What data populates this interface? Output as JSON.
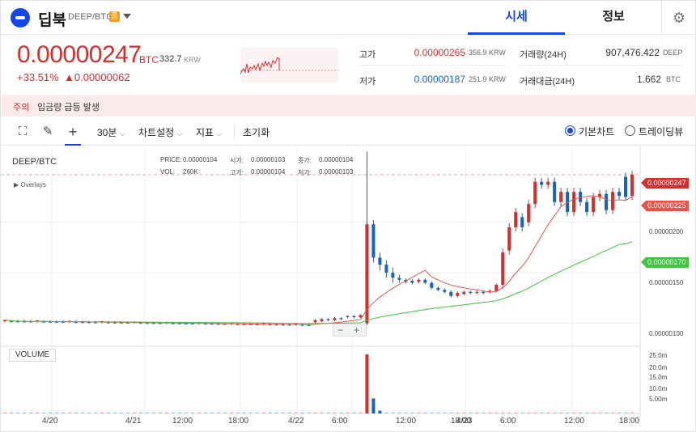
{
  "header": {
    "coin_name": "딥북",
    "pair": "DEEP/BTC",
    "pair_badge": "품",
    "tabs": [
      {
        "label": "시세"
      },
      {
        "label": "정보"
      }
    ]
  },
  "price": {
    "value": "0.00000247",
    "unit": "BTC",
    "krw": "332.7",
    "krw_unit": "KRW",
    "change_pct": "+33.51%",
    "change_abs": "▲0.00000062"
  },
  "stats": {
    "high_label": "고가",
    "high_value": "0.00000265",
    "high_krw": "356.9 KRW",
    "low_label": "저가",
    "low_value": "0.00000187",
    "low_krw": "251.9 KRW",
    "volume_label": "거래량(24H)",
    "volume_value": "907,476.422",
    "volume_unit": "DEEP",
    "amount_label": "거래대금(24H)",
    "amount_value": "1.662",
    "amount_unit": "BTC"
  },
  "alert": {
    "tag": "주의",
    "text": "입금량 급등 발생"
  },
  "toolbar": {
    "interval": "30분",
    "chart_settings": "차트설정",
    "indicators": "지표",
    "reset": "초기화",
    "basic_chart": "기본차트",
    "tradingview": "트레이딩뷰"
  },
  "legend": {
    "pair": "DEEP/BTC",
    "price_label": "PRICE:",
    "price_value": "0.00000104",
    "open_label": "시가:",
    "open_value": "0.00000103",
    "close_label": "종가:",
    "close_value": "0.00000104",
    "vol_label": "VOL:",
    "vol_value": "260K",
    "high_label": "고가:",
    "high_value": "0.00000104",
    "low_label": "저가:",
    "low_value": "0.00000103",
    "overlays": "▶ Overlays",
    "volume_btn": "VOLUME"
  },
  "price_tags": {
    "last": "0.00000247",
    "ma_short": "0.00000225",
    "ma_long": "0.00000170"
  },
  "colors": {
    "up": "#d32f2f",
    "down": "#1565c0",
    "ma_short": "#e5534b",
    "ma_long": "#3ec43e",
    "accent": "#1447e6"
  },
  "chart_data": {
    "type": "candlestick",
    "y_axis_labels": [
      "0.00000200",
      "0.00000150",
      "0.00000100"
    ],
    "volume_axis_labels": [
      "25.0m",
      "20.0m",
      "15.0m",
      "10.0m",
      "5.00m"
    ],
    "x_axis_labels": [
      "4/20",
      "4/21",
      "12:00",
      "18:00",
      "4/22",
      "6:00",
      "12:00",
      "18:00",
      "4/23",
      "6:00",
      "12:00",
      "18:00"
    ],
    "ylim": [
      7.8e-07,
      2.75e-06
    ],
    "volume_ylim": [
      0,
      28000000
    ],
    "candles": [
      {
        "o": 1.03,
        "h": 1.04,
        "l": 1.02,
        "c": 1.03,
        "v": 0.3
      },
      {
        "o": 1.03,
        "h": 1.03,
        "l": 1.01,
        "c": 1.02,
        "v": 0.2
      },
      {
        "o": 1.02,
        "h": 1.03,
        "l": 1.01,
        "c": 1.02,
        "v": 0.2
      },
      {
        "o": 1.02,
        "h": 1.03,
        "l": 1.01,
        "c": 1.02,
        "v": 0.2
      },
      {
        "o": 1.02,
        "h": 1.03,
        "l": 1.01,
        "c": 1.02,
        "v": 0.2
      },
      {
        "o": 1.02,
        "h": 1.03,
        "l": 1.0,
        "c": 1.01,
        "v": 0.2
      },
      {
        "o": 1.01,
        "h": 1.02,
        "l": 1.0,
        "c": 1.01,
        "v": 0.2
      },
      {
        "o": 1.01,
        "h": 1.02,
        "l": 1.0,
        "c": 1.01,
        "v": 0.2
      },
      {
        "o": 1.01,
        "h": 1.02,
        "l": 1.0,
        "c": 1.01,
        "v": 0.2
      },
      {
        "o": 1.01,
        "h": 1.02,
        "l": 0.99,
        "c": 1.0,
        "v": 0.2
      },
      {
        "o": 1.0,
        "h": 1.01,
        "l": 0.99,
        "c": 1.0,
        "v": 0.2
      },
      {
        "o": 1.0,
        "h": 1.01,
        "l": 0.99,
        "c": 1.0,
        "v": 0.2
      },
      {
        "o": 1.0,
        "h": 1.01,
        "l": 0.99,
        "c": 1.0,
        "v": 0.2
      },
      {
        "o": 1.0,
        "h": 1.01,
        "l": 0.99,
        "c": 1.0,
        "v": 0.2
      },
      {
        "o": 1.0,
        "h": 1.01,
        "l": 0.99,
        "c": 0.99,
        "v": 0.2
      },
      {
        "o": 0.99,
        "h": 1.0,
        "l": 0.98,
        "c": 0.99,
        "v": 0.2
      },
      {
        "o": 0.99,
        "h": 1.0,
        "l": 0.98,
        "c": 0.99,
        "v": 0.2
      },
      {
        "o": 0.99,
        "h": 1.0,
        "l": 0.98,
        "c": 0.99,
        "v": 0.2
      },
      {
        "o": 0.99,
        "h": 1.0,
        "l": 0.97,
        "c": 0.98,
        "v": 0.2
      },
      {
        "o": 0.98,
        "h": 0.99,
        "l": 0.97,
        "c": 0.98,
        "v": 0.2
      },
      {
        "o": 0.98,
        "h": 0.99,
        "l": 0.97,
        "c": 0.98,
        "v": 0.2
      },
      {
        "o": 0.98,
        "h": 0.99,
        "l": 0.97,
        "c": 0.98,
        "v": 0.2
      },
      {
        "o": 0.98,
        "h": 0.99,
        "l": 0.97,
        "c": 0.98,
        "v": 0.2
      },
      {
        "o": 0.98,
        "h": 0.99,
        "l": 0.97,
        "c": 0.98,
        "v": 0.2
      },
      {
        "o": 0.98,
        "h": 0.99,
        "l": 0.97,
        "c": 0.98,
        "v": 0.2
      },
      {
        "o": 0.98,
        "h": 0.99,
        "l": 0.97,
        "c": 0.98,
        "v": 0.2
      },
      {
        "o": 0.98,
        "h": 0.99,
        "l": 0.97,
        "c": 0.98,
        "v": 0.2
      },
      {
        "o": 0.98,
        "h": 0.99,
        "l": 0.97,
        "c": 0.98,
        "v": 0.2
      },
      {
        "o": 0.98,
        "h": 0.99,
        "l": 0.97,
        "c": 0.98,
        "v": 0.2
      },
      {
        "o": 0.98,
        "h": 0.99,
        "l": 0.97,
        "c": 0.98,
        "v": 0.2
      },
      {
        "o": 0.98,
        "h": 0.99,
        "l": 0.97,
        "c": 0.98,
        "v": 0.2
      },
      {
        "o": 0.98,
        "h": 0.99,
        "l": 0.97,
        "c": 0.98,
        "v": 0.2
      },
      {
        "o": 0.98,
        "h": 0.99,
        "l": 0.97,
        "c": 0.98,
        "v": 0.2
      },
      {
        "o": 0.98,
        "h": 0.99,
        "l": 0.97,
        "c": 0.98,
        "v": 0.2
      },
      {
        "o": 0.98,
        "h": 0.99,
        "l": 0.97,
        "c": 0.98,
        "v": 0.2
      },
      {
        "o": 0.98,
        "h": 0.99,
        "l": 0.97,
        "c": 0.98,
        "v": 0.2
      },
      {
        "o": 0.98,
        "h": 0.99,
        "l": 0.97,
        "c": 0.98,
        "v": 0.2
      },
      {
        "o": 0.98,
        "h": 0.99,
        "l": 0.97,
        "c": 0.98,
        "v": 0.2
      },
      {
        "o": 0.98,
        "h": 0.99,
        "l": 0.97,
        "c": 0.98,
        "v": 0.2
      },
      {
        "o": 0.98,
        "h": 0.99,
        "l": 0.97,
        "c": 0.98,
        "v": 0.2
      },
      {
        "o": 0.98,
        "h": 0.99,
        "l": 0.97,
        "c": 0.98,
        "v": 0.2
      },
      {
        "o": 0.98,
        "h": 0.99,
        "l": 0.97,
        "c": 0.98,
        "v": 0.2
      },
      {
        "o": 0.98,
        "h": 0.99,
        "l": 0.97,
        "c": 0.98,
        "v": 0.2
      },
      {
        "o": 0.98,
        "h": 0.99,
        "l": 0.97,
        "c": 0.98,
        "v": 0.2
      },
      {
        "o": 0.98,
        "h": 0.99,
        "l": 0.97,
        "c": 0.98,
        "v": 0.2
      },
      {
        "o": 0.98,
        "h": 0.99,
        "l": 0.97,
        "c": 0.98,
        "v": 0.2
      },
      {
        "o": 0.98,
        "h": 0.99,
        "l": 0.97,
        "c": 0.98,
        "v": 0.2
      },
      {
        "o": 0.98,
        "h": 0.99,
        "l": 0.97,
        "c": 0.98,
        "v": 0.2
      },
      {
        "o": 0.98,
        "h": 0.99,
        "l": 0.97,
        "c": 0.98,
        "v": 0.2
      },
      {
        "o": 0.98,
        "h": 0.99,
        "l": 0.97,
        "c": 0.98,
        "v": 0.2
      },
      {
        "o": 0.98,
        "h": 0.99,
        "l": 0.97,
        "c": 0.98,
        "v": 0.2
      },
      {
        "o": 0.98,
        "h": 0.99,
        "l": 0.97,
        "c": 0.98,
        "v": 0.2
      }
    ]
  }
}
